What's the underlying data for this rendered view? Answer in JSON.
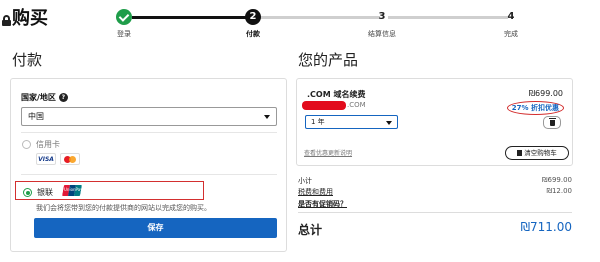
{
  "header": {
    "title": "购买"
  },
  "stepper": {
    "steps": [
      {
        "num": "",
        "label": "登录",
        "state": "done"
      },
      {
        "num": "2",
        "label": "付款",
        "state": "current"
      },
      {
        "num": "3",
        "label": "结算信息",
        "state": "pending"
      },
      {
        "num": "4",
        "label": "完成",
        "state": "pending"
      }
    ]
  },
  "payment": {
    "heading": "付款",
    "country_label": "国家/地区",
    "country_value": "中国",
    "options": {
      "credit_card": "信用卡",
      "visa": "VISA",
      "unionpay": "银联",
      "unionpay_logo": "UnionPay"
    },
    "unionpay_note": "我们会将您带到您的付款提供商的网站以完成您的购买。",
    "save_button": "保存"
  },
  "products": {
    "heading": "您的产品",
    "item": {
      "name": ".COM 域名续费",
      "price": "₪699.00",
      "domain_suffix": ".COM",
      "discount": "27% 折扣优惠",
      "term": "1 年"
    },
    "policy_link": "查看优惠更新说明",
    "clear_cart": "清空购物车"
  },
  "summary": {
    "subtotal_label": "小计",
    "subtotal_value": "₪699.00",
    "tax_label": "税费和费用",
    "tax_value": "₪12.00",
    "promo_label": "是否有促销码？",
    "total_label": "总计",
    "total_value": "₪711.00"
  },
  "colors": {
    "accent": "#1565c0",
    "success": "#1f9d4a",
    "highlight": "#d32f2f"
  }
}
